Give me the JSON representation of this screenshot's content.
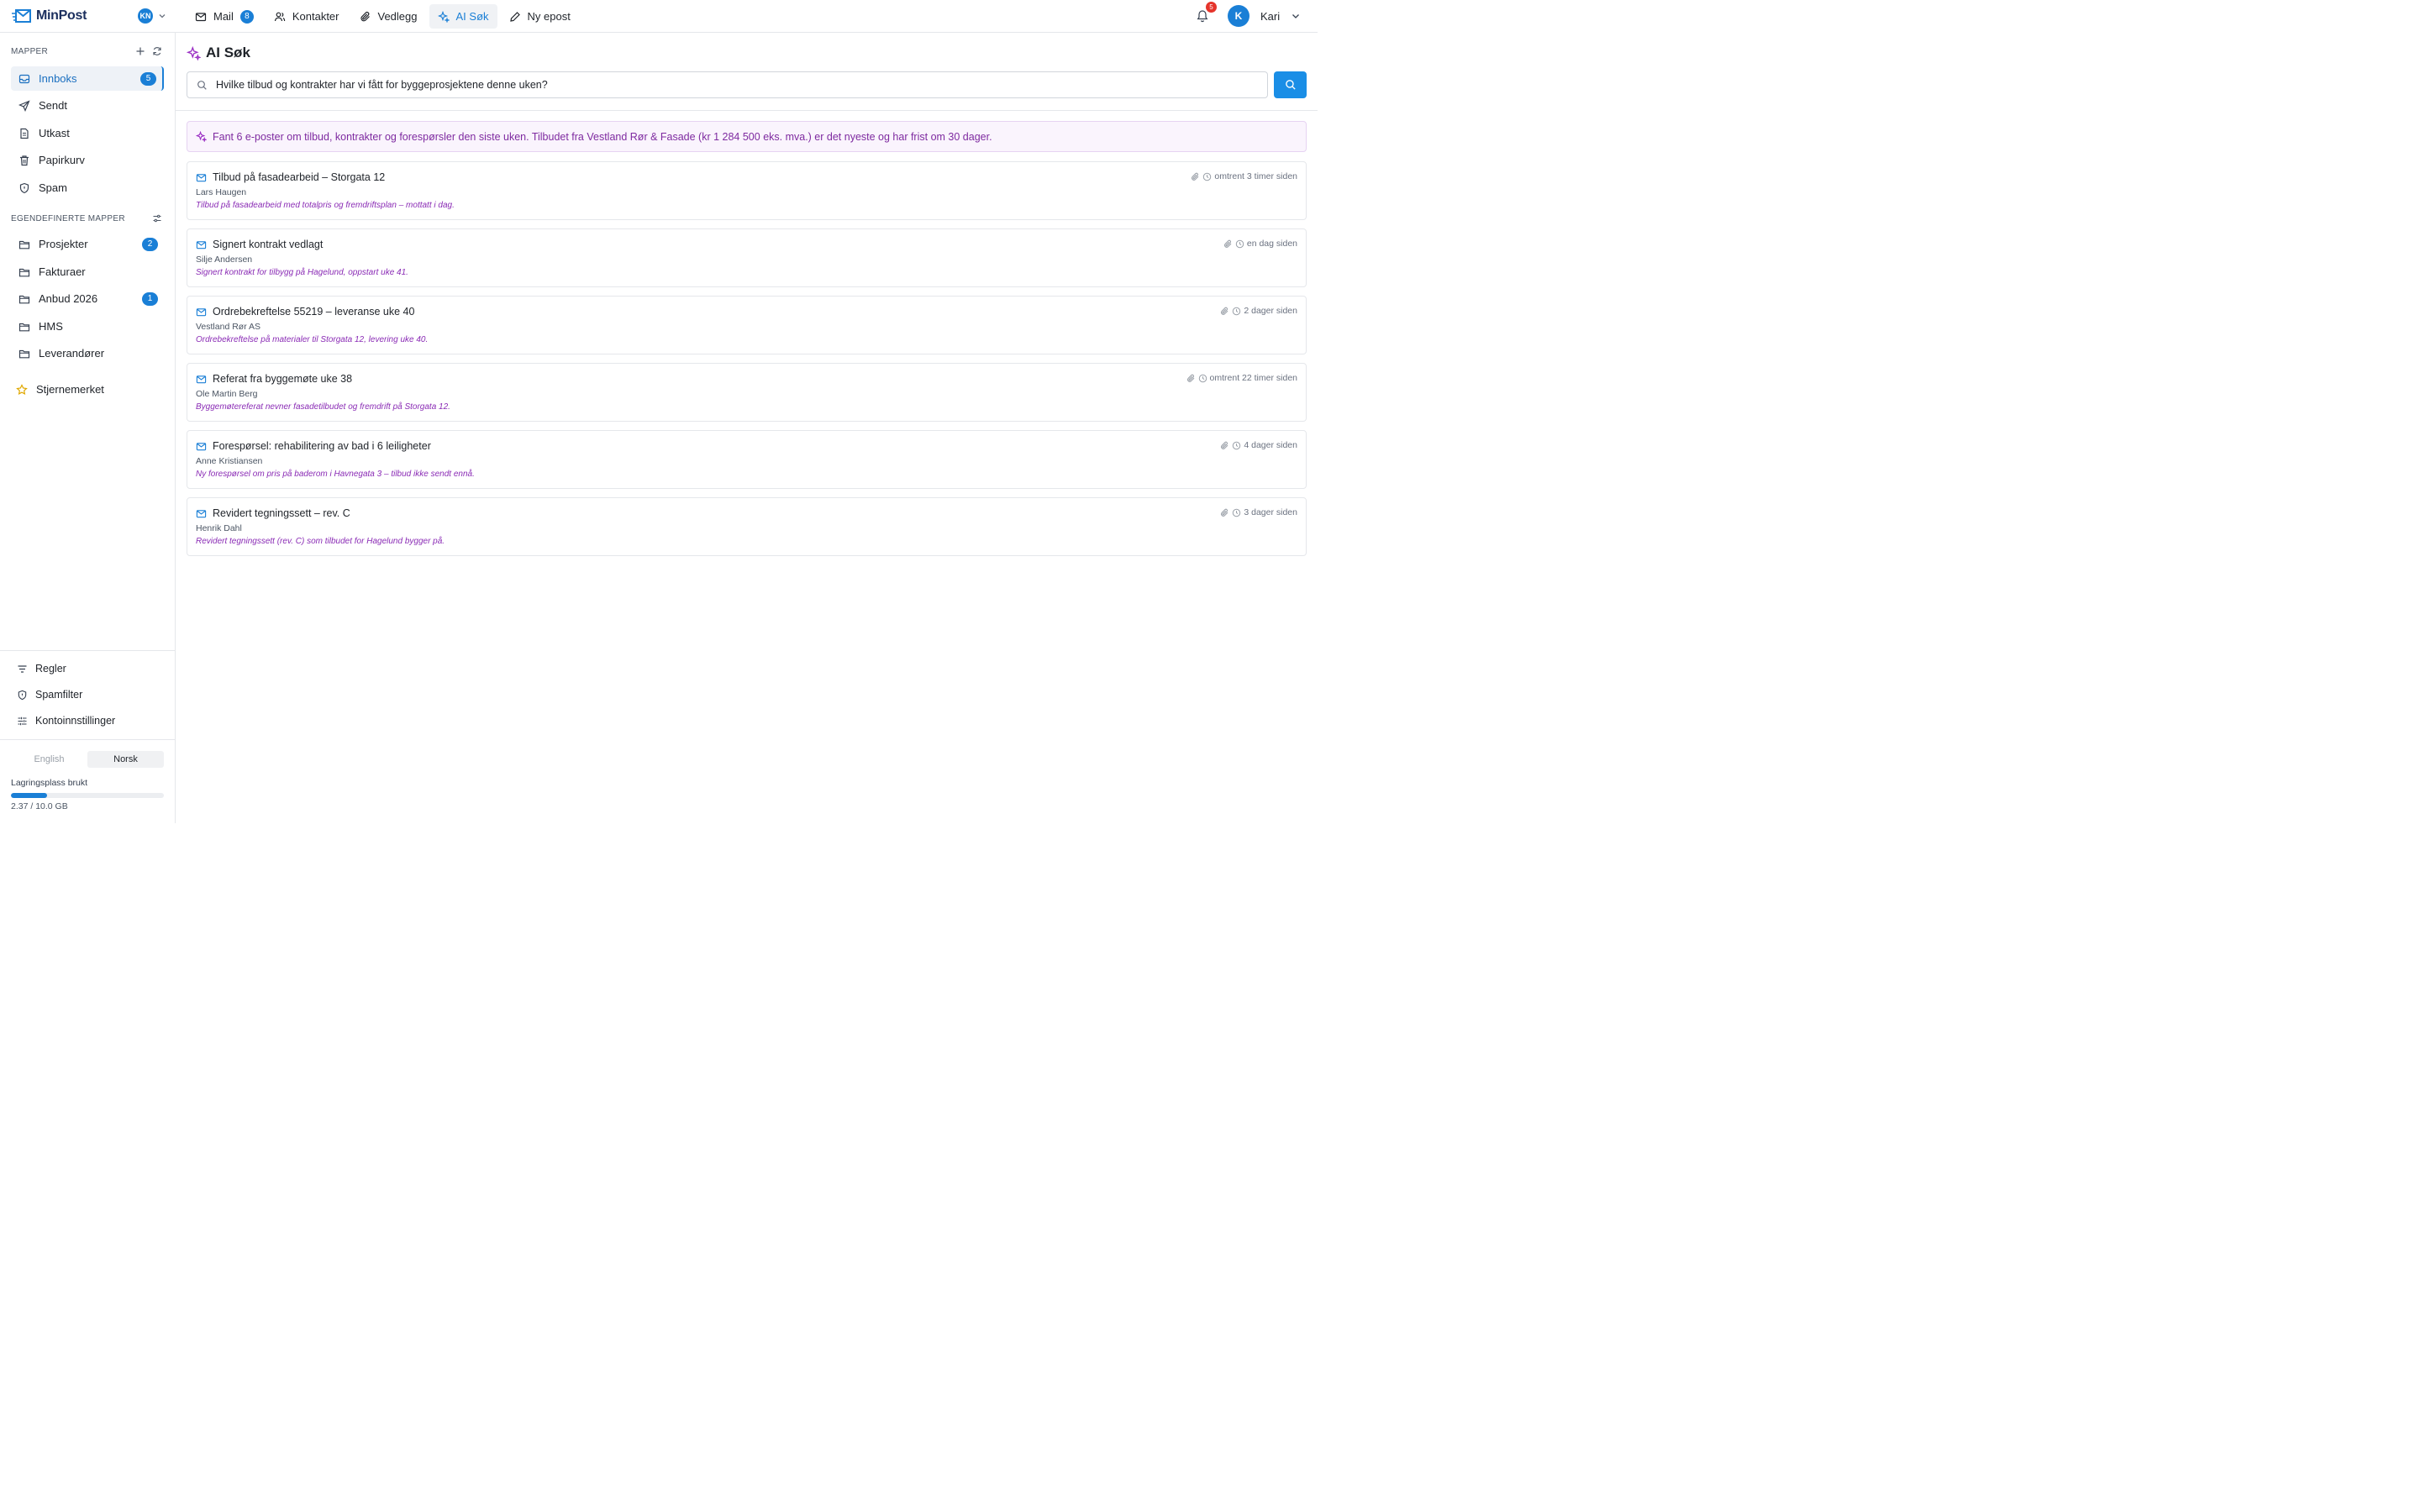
{
  "app": {
    "brand": "MinPost",
    "account_initials": "KN",
    "user_initial": "K",
    "user_name": "Kari",
    "notifications_count": "5",
    "accent_color": "#1a7fd6"
  },
  "nav": [
    {
      "label": "Mail",
      "icon": "mail-icon",
      "count": "8"
    },
    {
      "label": "Kontakter",
      "icon": "contacts-icon"
    },
    {
      "label": "Vedlegg",
      "icon": "paperclip-icon"
    },
    {
      "label": "AI Søk",
      "icon": "sparkles-icon",
      "active": true
    },
    {
      "label": "Ny epost",
      "icon": "pencil-icon"
    }
  ],
  "sidebar": {
    "folders_title": "MAPPER",
    "folders": [
      {
        "label": "Innboks",
        "icon": "inbox-icon",
        "count": "5"
      },
      {
        "label": "Sendt",
        "icon": "send-icon"
      },
      {
        "label": "Utkast",
        "icon": "draft-icon"
      },
      {
        "label": "Papirkurv",
        "icon": "trash-icon"
      },
      {
        "label": "Spam",
        "icon": "shield-icon"
      }
    ],
    "custom_title": "EGENDEFINERTE MAPPER",
    "custom_folders": [
      {
        "label": "Prosjekter",
        "count": "2"
      },
      {
        "label": "Fakturaer"
      },
      {
        "label": "Anbud 2026",
        "count": "1"
      },
      {
        "label": "HMS"
      },
      {
        "label": "Leverandører"
      }
    ],
    "starred": "Stjernemerket",
    "bottom_links": [
      {
        "label": "Regler",
        "icon": "filter-lines-icon"
      },
      {
        "label": "Spamfilter",
        "icon": "shield-icon"
      },
      {
        "label": "Kontoinnstillinger",
        "icon": "sliders-icon"
      }
    ],
    "languages": [
      "English",
      "Norsk"
    ],
    "active_language": "Norsk",
    "storage_label": "Lagringsplass brukt",
    "storage_value": "2.37 / 10.0 GB",
    "storage_fraction": 0.237
  },
  "main": {
    "title": "AI Søk",
    "search_query": "Hvilke tilbud og kontrakter har vi fått for byggeprosjektene denne uken?",
    "ai_summary": "Fant 6 e-poster om tilbud, kontrakter og forespørsler den siste uken. Tilbudet fra Vestland Rør & Fasade (kr 1 284 500 eks. mva.) er det nyeste og har frist om 30 dager.",
    "results": [
      {
        "subject": "Tilbud på fasadearbeid – Storgata 12",
        "from": "Lars Haugen",
        "snippet": "Tilbud på fasadearbeid med totalpris og fremdriftsplan – mottatt i dag.",
        "time": "omtrent 3 timer siden"
      },
      {
        "subject": "Signert kontrakt vedlagt",
        "from": "Silje Andersen",
        "snippet": "Signert kontrakt for tilbygg på Hagelund, oppstart uke 41.",
        "time": "en dag siden"
      },
      {
        "subject": "Ordrebekreftelse 55219 – leveranse uke 40",
        "from": "Vestland Rør AS",
        "snippet": "Ordrebekreftelse på materialer til Storgata 12, levering uke 40.",
        "time": "2 dager siden"
      },
      {
        "subject": "Referat fra byggemøte uke 38",
        "from": "Ole Martin Berg",
        "snippet": "Byggemøtereferat nevner fasadetilbudet og fremdrift på Storgata 12.",
        "time": "omtrent 22 timer siden"
      },
      {
        "subject": "Forespørsel: rehabilitering av bad i 6 leiligheter",
        "from": "Anne Kristiansen",
        "snippet": "Ny forespørsel om pris på baderom i Havnegata 3 – tilbud ikke sendt ennå.",
        "time": "4 dager siden"
      },
      {
        "subject": "Revidert tegningssett – rev. C",
        "from": "Henrik Dahl",
        "snippet": "Revidert tegningssett (rev. C) som tilbudet for Hagelund bygger på.",
        "time": "3 dager siden"
      }
    ]
  }
}
